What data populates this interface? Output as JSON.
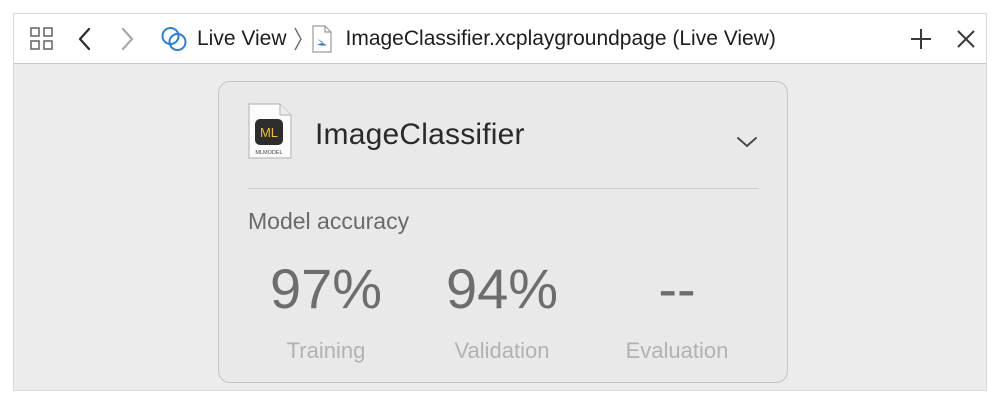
{
  "toolbar": {
    "grid_icon": "related-items-grid-icon",
    "back_icon": "chevron-left-icon",
    "forward_icon": "chevron-right-icon",
    "add_icon": "plus-icon",
    "close_icon": "close-icon",
    "breadcrumb": [
      {
        "label": "Live View",
        "icon": "live-view-rings-icon"
      },
      {
        "label": "ImageClassifier.xcplaygroundpage (Live View)",
        "icon": "swift-file-icon"
      }
    ],
    "accent_color": "#2a7de1"
  },
  "card": {
    "model_icon_text": "ML",
    "model_icon_caption": "MLMODEL",
    "model_name": "ImageClassifier",
    "expand_icon": "chevron-down-icon",
    "section_label": "Model accuracy",
    "metrics": [
      {
        "value": "97%",
        "label": "Training"
      },
      {
        "value": "94%",
        "label": "Validation"
      },
      {
        "value": "--",
        "label": "Evaluation"
      }
    ]
  }
}
